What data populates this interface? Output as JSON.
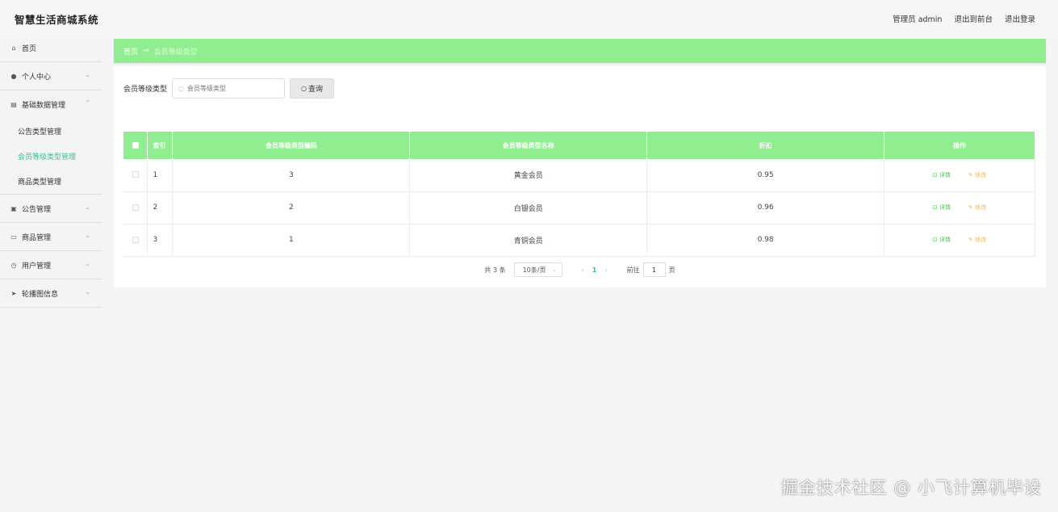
{
  "header": {
    "app_title": "智慧生活商城系统",
    "admin_label": "管理员 admin",
    "to_front": "退出到前台",
    "logout": "退出登录"
  },
  "sidebar": {
    "items": [
      {
        "label": "首页",
        "icon": "home-icon"
      },
      {
        "label": "个人中心",
        "icon": "user-icon"
      },
      {
        "label": "基础数据管理",
        "icon": "database-icon"
      },
      {
        "label": "公告管理",
        "icon": "document-icon"
      },
      {
        "label": "商品管理",
        "icon": "message-icon"
      },
      {
        "label": "用户管理",
        "icon": "clock-icon"
      },
      {
        "label": "轮播图信息",
        "icon": "send-icon"
      }
    ],
    "subitems": [
      {
        "label": "公告类型管理"
      },
      {
        "label": "会员等级类型管理"
      },
      {
        "label": "商品类型管理"
      }
    ]
  },
  "breadcrumb": {
    "home": "首页",
    "current": "会员等级类型"
  },
  "search": {
    "label": "会员等级类型",
    "placeholder": "会员等级类型",
    "button": "查询"
  },
  "table": {
    "headers": [
      "索引",
      "会员等级类型编码",
      "会员等级类型名称",
      "折扣",
      "操作"
    ],
    "rows": [
      {
        "index": "1",
        "code": "3",
        "name": "黄金会员",
        "discount": "0.95"
      },
      {
        "index": "2",
        "code": "2",
        "name": "白银会员",
        "discount": "0.96"
      },
      {
        "index": "3",
        "code": "1",
        "name": "青铜会员",
        "discount": "0.98"
      }
    ],
    "detail_label": "详情",
    "edit_label": "修改"
  },
  "pagination": {
    "total": "共 3 条",
    "page_size": "10条/页",
    "current_page": "1",
    "goto_label": "前往",
    "goto_value": "1",
    "page_suffix": "页"
  },
  "watermark": "掘金技术社区 @ 小飞计算机毕设"
}
